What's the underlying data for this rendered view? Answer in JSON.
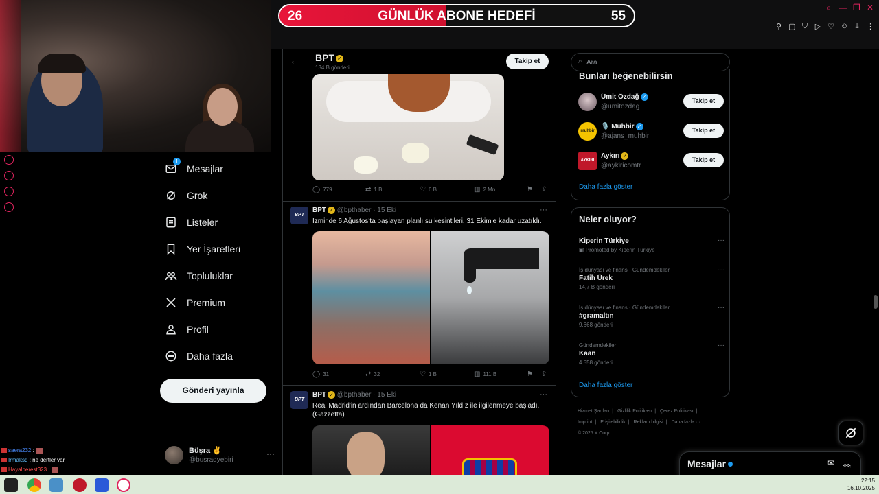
{
  "goal": {
    "current": "26",
    "title": "GÜNLÜK ABONE HEDEFİ",
    "target": "55",
    "progress": 0.47
  },
  "nav": {
    "items": [
      {
        "label": "Mesajlar",
        "icon": "mail-icon",
        "badge": "1"
      },
      {
        "label": "Grok",
        "icon": "grok-icon"
      },
      {
        "label": "Listeler",
        "icon": "list-icon"
      },
      {
        "label": "Yer İşaretleri",
        "icon": "bookmark-icon"
      },
      {
        "label": "Topluluklar",
        "icon": "communities-icon"
      },
      {
        "label": "Premium",
        "icon": "x-logo-icon"
      },
      {
        "label": "Profil",
        "icon": "profile-icon"
      },
      {
        "label": "Daha fazla",
        "icon": "more-circle-icon"
      }
    ],
    "post_button": "Gönderi yayınla",
    "account": {
      "name": "Büşra ✌️",
      "handle": "@busradyebiri",
      "more": "···"
    }
  },
  "chat": [
    {
      "user": "saera232",
      "sep": ":",
      "text": ""
    },
    {
      "user": "Irmaksd",
      "sep": ":",
      "text": "ne dertler var"
    },
    {
      "user": "Hayalperest323",
      "sep": ":",
      "text": ""
    }
  ],
  "header": {
    "name": "BPT",
    "count": "134 B gönderi",
    "follow": "Takip et",
    "back": "←"
  },
  "tweets": [
    {
      "replies": "779",
      "reposts": "1 B",
      "likes": "6 B",
      "views": "2 Mn"
    },
    {
      "avatar": "BPT",
      "name": "BPT",
      "handle": "@bpthaber",
      "date": "· 15 Eki",
      "text": "İzmir'de 6 Ağustos'ta başlayan planlı su kesintileri, 31 Ekim'e kadar uzatıldı.",
      "replies": "31",
      "reposts": "32",
      "likes": "1 B",
      "views": "111 B"
    },
    {
      "avatar": "BPT",
      "name": "BPT",
      "handle": "@bpthaber",
      "date": "· 15 Eki",
      "text": "Real Madrid'in ardından Barcelona da Kenan Yıldız ile ilgilenmeye başladı. (Gazzetta)"
    }
  ],
  "search": {
    "placeholder": "Ara"
  },
  "who_to_follow": {
    "title": "Bunları beğenebilirsin",
    "people": [
      {
        "name": "Ümit Özdağ",
        "handle": "@umitozdag",
        "button": "Takip et",
        "badge": "blue"
      },
      {
        "name": "🎙️ Muhbir",
        "handle": "@ajans_muhbir",
        "button": "Takip et",
        "badge": "blue",
        "avatar_text": "muhbir"
      },
      {
        "name": "Aykırı",
        "handle": "@aykiricomtr",
        "button": "Takip et",
        "badge": "gold",
        "avatar_text": "AYKIRI"
      }
    ],
    "show_more": "Daha fazla göster"
  },
  "trends": {
    "title": "Neler oluyor?",
    "items": [
      {
        "context": "",
        "title": "Kiperin Türkiye",
        "count": "Promoted by Kiperin Türkiye"
      },
      {
        "context": "İş dünyası ve finans · Gündemdekiler",
        "title": "Fatih Ürek",
        "count": "14,7 B gönderi"
      },
      {
        "context": "İş dünyası ve finans · Gündemdekiler",
        "title": "#gramaltın",
        "count": "9.668 gönderi"
      },
      {
        "context": "Gündemdekiler",
        "title": "Kaan",
        "count": "4.558 gönderi"
      }
    ],
    "show_more": "Daha fazla göster"
  },
  "footer": {
    "links": [
      "Hizmet Şartları",
      "|",
      "Gizlilik Politikası",
      "|",
      "Çerez Politikası",
      "|",
      "Imprint",
      "|",
      "Erişilebilirlik",
      "|",
      "Reklam bilgisi",
      "|",
      "Daha fazla ···"
    ],
    "copyright": "© 2025 X Corp."
  },
  "messages_drawer": {
    "title": "Mesajlar"
  },
  "clock": {
    "time": "22:15",
    "date": "16.10.2025"
  },
  "colors": {
    "accent": "#1d9bf0",
    "goal_red": "#e8153a",
    "background": "#000000"
  }
}
